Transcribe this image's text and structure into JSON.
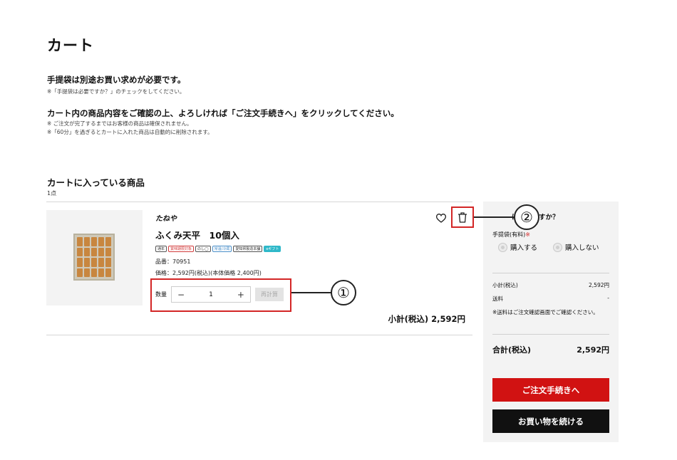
{
  "page": {
    "title": "カート"
  },
  "notices": {
    "bag_heading": "手提袋は別途お買い求めが必要です。",
    "bag_note": "※「手提袋は必要ですか？」のチェックをしてください。",
    "confirm_heading": "カート内の商品内容をご確認の上、よろしければ「ご注文手続きへ」をクリックしてください。",
    "confirm_note_1": "※ ご注文が完了するまではお客様の商品は確保されません。",
    "confirm_note_2": "※「60分」を過ぎるとカートに入れた商品は自動的に削除されます。"
  },
  "cart": {
    "section_title": "カートに入っている商品",
    "count": "1点",
    "item": {
      "brand": "たねや",
      "name": "ふくみ天平　10個入",
      "tags": [
        "通年",
        "賞味期限対象",
        "のし◯",
        "常温/冷蔵",
        "愛知県製造本舗",
        "eギフト"
      ],
      "sku": "品番：70951",
      "price": "価格：2,592円(税込)(本体価格 2,400円)",
      "qty_label": "数量",
      "qty_minus": "−",
      "qty_value": "1",
      "qty_plus": "+",
      "recalc": "再計算",
      "subtotal": "小計(税込) 2,592円"
    }
  },
  "icons": {
    "favorite": "heart-icon",
    "delete": "trash-icon"
  },
  "callouts": {
    "one": "①",
    "two": "②"
  },
  "summary": {
    "bag_question": "は必要ですか？",
    "bag_label": "手提袋(有料)",
    "bag_required": "※",
    "option_buy": "購入する",
    "option_nobuy": "購入しない",
    "subtotal_label": "小計(税込)",
    "subtotal_value": "2,592円",
    "shipping_label": "送料",
    "shipping_value": "-",
    "shipping_note": "※送料はご注文確認画面でご確認ください。",
    "total_label": "合計(税込)",
    "total_value": "2,592円",
    "checkout_button": "ご注文手続きへ",
    "continue_button": "お買い物を続ける"
  },
  "colors": {
    "accent_red": "#d11212",
    "callout_red": "#d32626",
    "panel_bg": "#f3f3f3"
  }
}
